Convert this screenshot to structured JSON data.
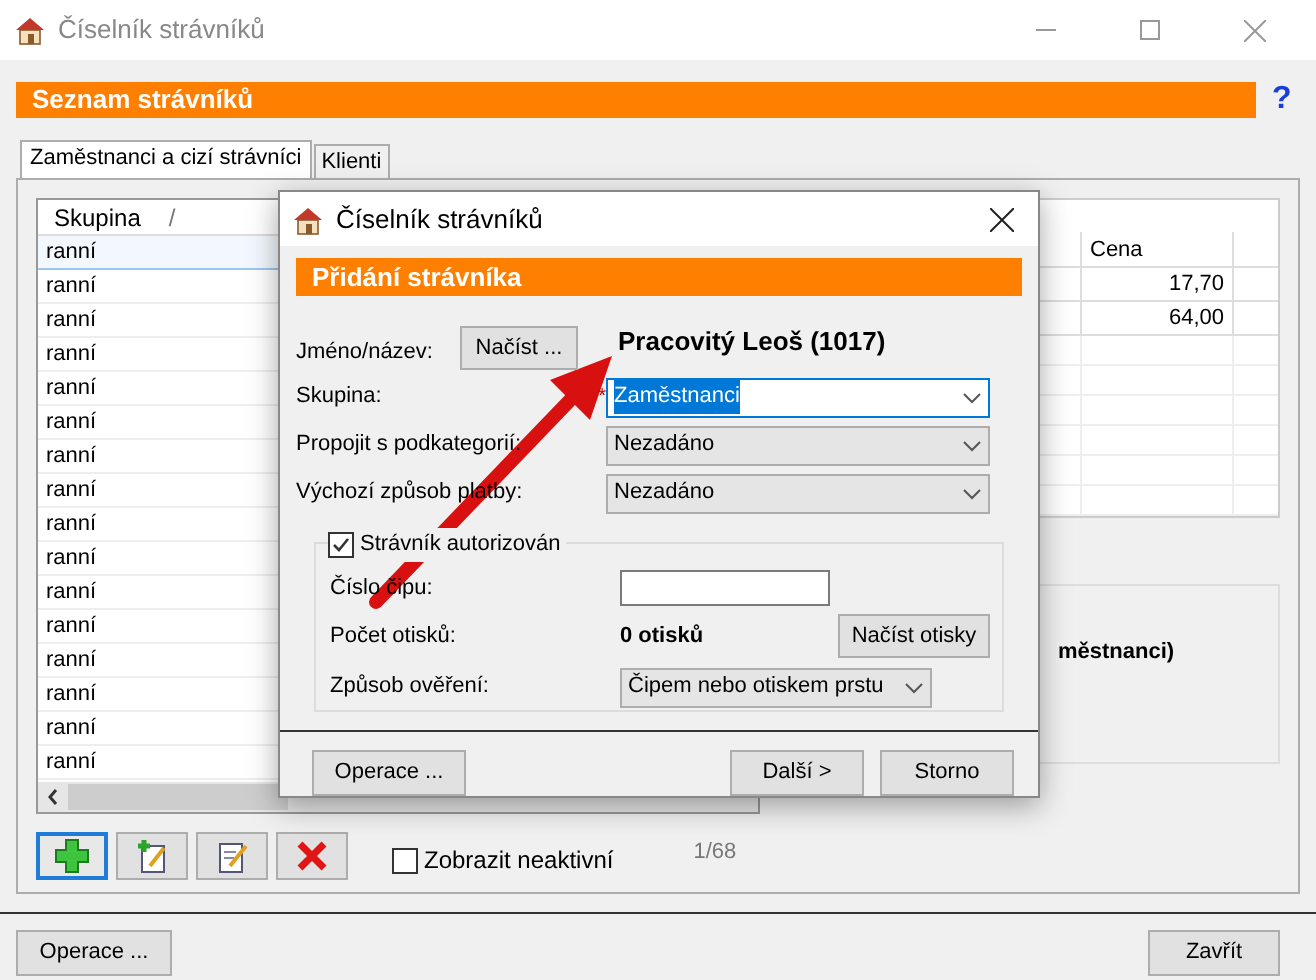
{
  "window": {
    "title": "Číselník strávníků",
    "help": "?"
  },
  "header": "Seznam strávníků",
  "tabs": [
    {
      "label": "Zaměstnanci a cizí strávníci",
      "selected": true
    },
    {
      "label": "Klienti",
      "selected": false
    }
  ],
  "table": {
    "column": "Skupina",
    "sort_mark": "/",
    "rows": [
      {
        "group": "ranní",
        "selected": true
      },
      {
        "group": "ranní",
        "selected": false
      },
      {
        "group": "ranní",
        "selected": false
      },
      {
        "group": "ranní",
        "selected": false
      },
      {
        "group": "ranní",
        "selected": false
      },
      {
        "group": "ranní",
        "selected": false
      },
      {
        "group": "ranní",
        "selected": false
      },
      {
        "group": "ranní",
        "selected": false
      },
      {
        "group": "ranní",
        "selected": false
      },
      {
        "group": "ranní",
        "selected": false
      },
      {
        "group": "ranní",
        "selected": false
      },
      {
        "group": "ranní",
        "selected": false
      },
      {
        "group": "ranní",
        "selected": false
      },
      {
        "group": "ranní",
        "selected": false
      },
      {
        "group": "ranní",
        "selected": false
      },
      {
        "group": "ranní",
        "selected": false
      }
    ]
  },
  "price_table": {
    "column": "Cena",
    "rows": [
      "17,70",
      "64,00"
    ]
  },
  "detail_text": "městnanci)",
  "show_inactive": {
    "label": "Zobrazit neaktivní",
    "checked": false
  },
  "count": "1/68",
  "footer_buttons": [
    "Operace ...",
    "Zavřít"
  ],
  "dialog": {
    "title": "Číselník strávníků",
    "header": "Přidání strávníka",
    "name_label": "Jméno/název:",
    "load_button": "Načíst ...",
    "name": "Pracovitý Leoš (1017)",
    "fields": [
      {
        "label": "Skupina:",
        "value": "Zaměstnanci",
        "required_mark": "*",
        "focused": true
      },
      {
        "label": "Propojit s podkategorií:",
        "value": "Nezadáno",
        "focused": false
      },
      {
        "label": "Výchozí způsob platby:",
        "value": "Nezadáno",
        "focused": false
      }
    ],
    "authorized": {
      "label": "Strávník autorizován",
      "checked": true
    },
    "chip_label": "Číslo čipu:",
    "prints_label": "Počet otisků:",
    "prints": "0 otisků",
    "load_prints_button": "Načíst otisky",
    "verify_label": "Způsob ověření:",
    "verify_value": "Čipem nebo otiskem prstu",
    "buttons": [
      "Operace ...",
      "Další >",
      "Storno"
    ]
  }
}
